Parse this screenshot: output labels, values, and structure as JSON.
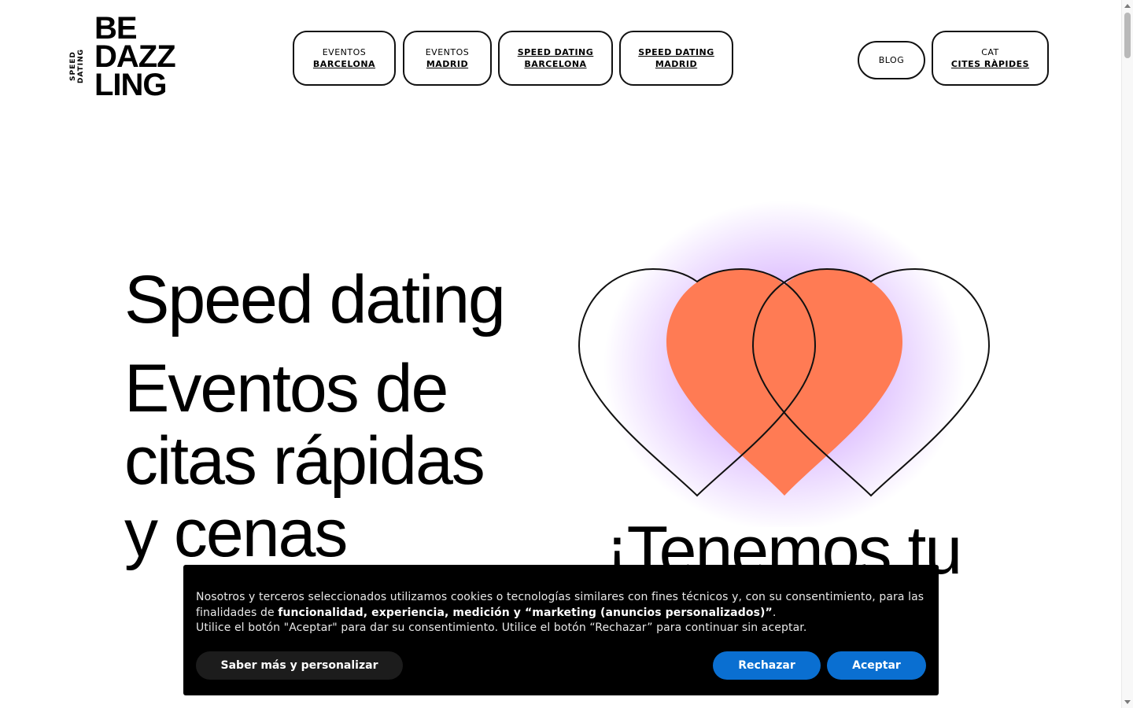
{
  "logo": {
    "side_lines": [
      "SPEED",
      "DATING"
    ],
    "main_lines": [
      "BE",
      "DAZZ",
      "LING"
    ]
  },
  "nav": {
    "items": [
      {
        "line1": "EVENTOS",
        "line2": "BARCELONA"
      },
      {
        "line1": "EVENTOS",
        "line2": "MADRID"
      },
      {
        "line1": "SPEED DATING",
        "line2": "BARCELONA"
      },
      {
        "line1": "SPEED DATING",
        "line2": "MADRID"
      }
    ],
    "blog": "BLOG",
    "lang": {
      "line1": "CAT",
      "line2": "CITES RÀPIDES"
    }
  },
  "hero": {
    "title": "Speed dating",
    "subtitle_lines": [
      "Eventos de",
      "citas rápidas",
      "y cenas"
    ],
    "tagline": "¡Tenemos tu"
  },
  "colors": {
    "heart_fill": "#ff7b54",
    "glow": "#b26bff"
  },
  "cookie": {
    "text_part1": "Nosotros y terceros seleccionados utilizamos cookies o tecnologías similares con fines técnicos y, con su consentimiento, para las finalidades de ",
    "text_bold": "funcionalidad, experiencia, medición y “marketing (anuncios personalizados)”",
    "text_part2": ".",
    "text_line2": "Utilice el botón \"Aceptar\" para dar su consentimiento. Utilice el botón “Rechazar” para continuar sin aceptar.",
    "more_label": "Saber más y personalizar",
    "reject_label": "Rechazar",
    "accept_label": "Aceptar"
  }
}
